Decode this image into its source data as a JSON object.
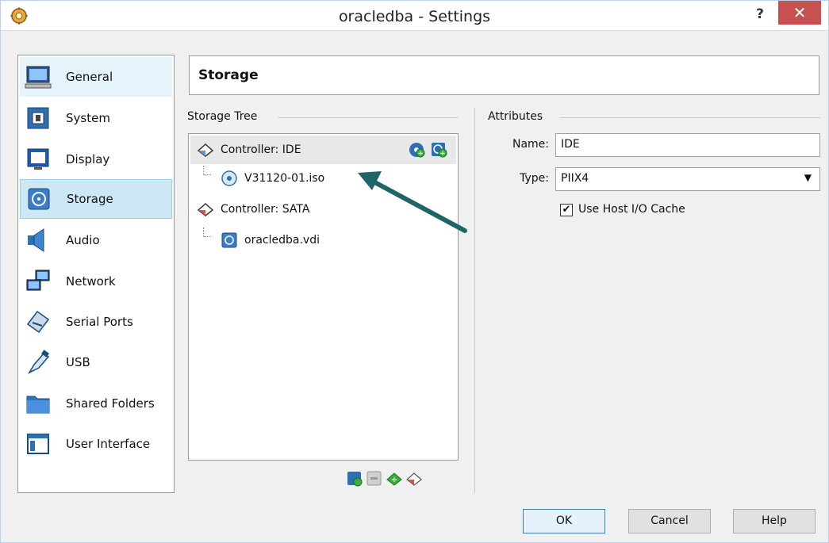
{
  "window": {
    "title": "oracledba - Settings",
    "help": "?",
    "close": "✕"
  },
  "sidebar": {
    "items": [
      {
        "label": "General",
        "icon": "general-monitor-icon"
      },
      {
        "label": "System",
        "icon": "system-chip-icon"
      },
      {
        "label": "Display",
        "icon": "display-monitor-icon"
      },
      {
        "label": "Storage",
        "icon": "storage-disk-icon",
        "selected": true
      },
      {
        "label": "Audio",
        "icon": "audio-speaker-icon"
      },
      {
        "label": "Network",
        "icon": "network-icon"
      },
      {
        "label": "Serial Ports",
        "icon": "serial-port-icon"
      },
      {
        "label": "USB",
        "icon": "usb-icon"
      },
      {
        "label": "Shared Folders",
        "icon": "folder-icon"
      },
      {
        "label": "User Interface",
        "icon": "user-interface-icon"
      }
    ]
  },
  "header": {
    "title": "Storage"
  },
  "storage_tree": {
    "label": "Storage Tree",
    "rows": [
      {
        "label": "Controller: IDE",
        "type": "controller"
      },
      {
        "label": "V31120-01.iso",
        "type": "optical"
      },
      {
        "label": "Controller: SATA",
        "type": "controller"
      },
      {
        "label": "oracledba.vdi",
        "type": "disk"
      }
    ]
  },
  "attributes": {
    "label": "Attributes",
    "name_label": "Name:",
    "name_value": "IDE",
    "type_label": "Type:",
    "type_value": "PIIX4",
    "cache_label": "Use Host I/O Cache",
    "cache_checked": true,
    "check_mark": "✔"
  },
  "buttons": {
    "ok": "OK",
    "cancel": "Cancel",
    "help": "Help"
  },
  "colors": {
    "accent": "#3c7fb1",
    "selected_bg": "#cce8f4",
    "arrow": "#1f6466",
    "close": "#c75050"
  }
}
